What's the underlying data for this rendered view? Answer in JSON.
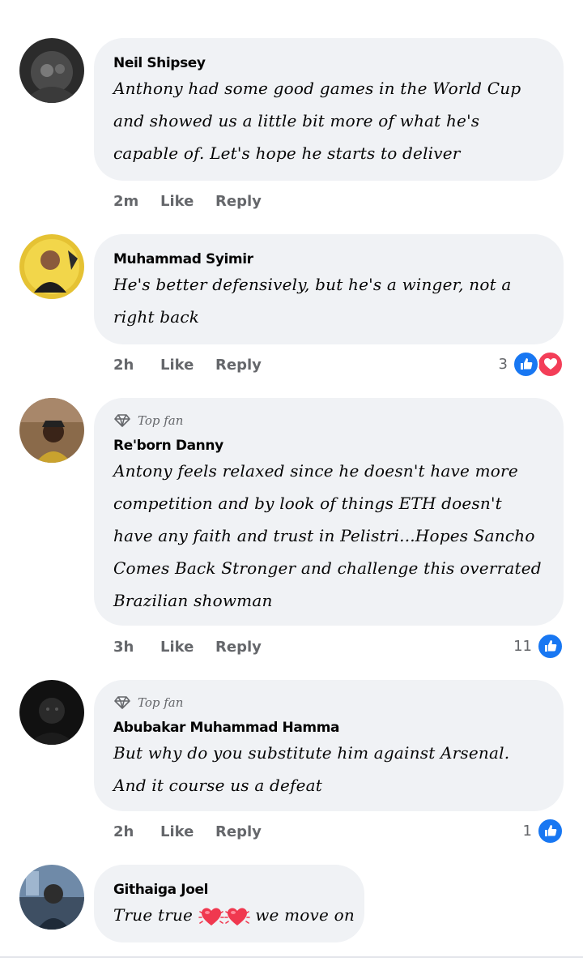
{
  "comments": [
    {
      "author": "Neil Shipsey",
      "top_fan": false,
      "text": "Anthony had some good games in the World Cup and showed us a little bit more of what he's capable of. Let's hope he starts to deliver",
      "time": "2m",
      "like_label": "Like",
      "reply_label": "Reply",
      "reaction_count": "",
      "reactions": []
    },
    {
      "author": "Muhammad Syimir",
      "top_fan": false,
      "text": "He's better defensively, but he's a winger, not a right back",
      "time": "2h",
      "like_label": "Like",
      "reply_label": "Reply",
      "reaction_count": "3",
      "reactions": [
        "like-icon",
        "love-icon"
      ]
    },
    {
      "author": "Re'born Danny",
      "top_fan": true,
      "badge_label": "Top fan",
      "text": "Antony feels relaxed since he doesn't have more competition and by look of things ETH doesn't have any faith and trust in Pelistri...Hopes Sancho Comes Back Stronger and challenge this overrated Brazilian showman",
      "time": "3h",
      "like_label": "Like",
      "reply_label": "Reply",
      "reaction_count": "11",
      "reactions": [
        "like-icon"
      ]
    },
    {
      "author": "Abubakar Muhammad Hamma",
      "top_fan": true,
      "badge_label": "Top fan",
      "text": "But why do you substitute him against Arsenal. And it course us a defeat",
      "time": "2h",
      "like_label": "Like",
      "reply_label": "Reply",
      "reaction_count": "1",
      "reactions": [
        "like-icon"
      ]
    },
    {
      "author": "Githaiga Joel",
      "top_fan": false,
      "text_before": "True true",
      "text_after": "we move on",
      "emoji": [
        "heart-icon",
        "heart-icon"
      ]
    }
  ],
  "colors": {
    "bubble": "#f0f2f5",
    "meta": "#65676b",
    "like_blue": "#1877f2",
    "love_red": "#f33e58"
  }
}
